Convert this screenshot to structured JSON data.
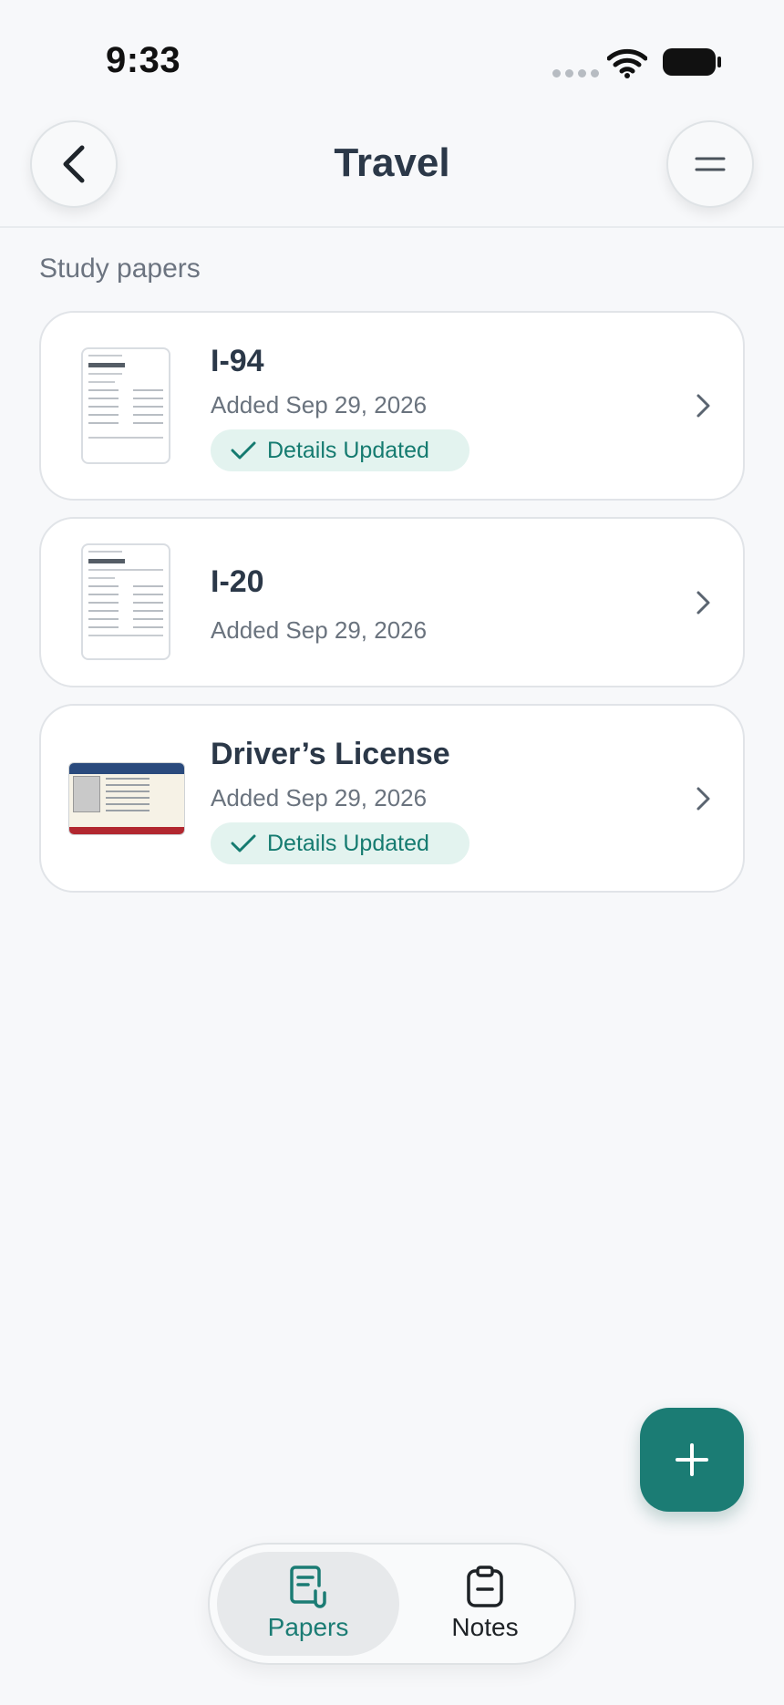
{
  "status_bar": {
    "time": "9:33"
  },
  "header": {
    "title": "Travel"
  },
  "section": {
    "label": "Study papers"
  },
  "papers": [
    {
      "title": "I-94",
      "date": "Added Sep 29, 2026",
      "badge": "Details Updated"
    },
    {
      "title": "I-20",
      "date": "Added Sep 29, 2026"
    },
    {
      "title": "Driver’s License",
      "date": "Added Sep 29, 2026",
      "badge": "Details Updated"
    }
  ],
  "tabs": [
    {
      "label": "Papers",
      "active": true
    },
    {
      "label": "Notes",
      "active": false
    }
  ],
  "colors": {
    "accent": "#1b7c74",
    "badge_bg": "#e3f3ef",
    "badge_text": "#157b70"
  }
}
